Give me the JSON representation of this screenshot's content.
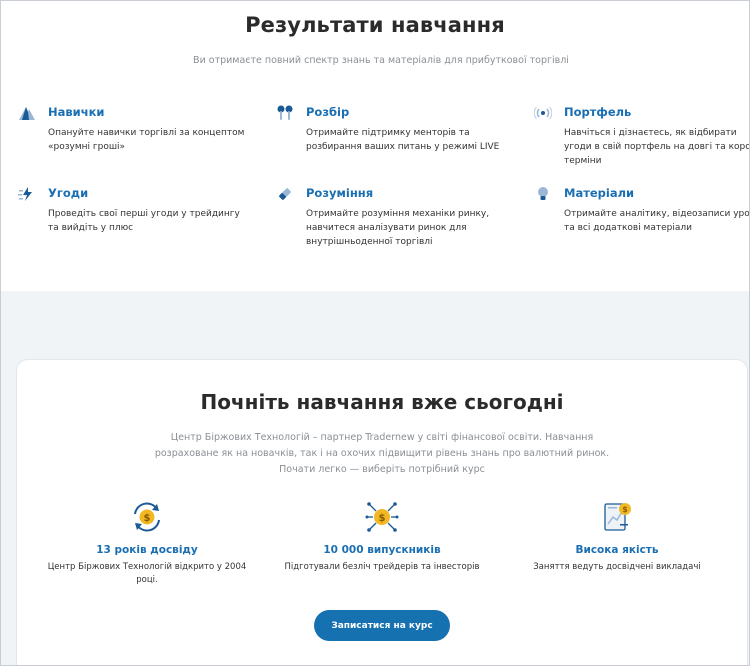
{
  "results": {
    "title": "Результати навчання",
    "subtitle": "Ви отримаєте повний спектр знань та матеріалів для прибуткової торгівлі",
    "features": [
      {
        "icon": "mountain-icon",
        "title": "Навички",
        "desc": "Опануйте навички торгівлі за концептом «розумні гроші»"
      },
      {
        "icon": "earbuds-icon",
        "title": "Розбір",
        "desc": "Отримайте підтримку менторів та розбирання ваших питань у режимі LIVE"
      },
      {
        "icon": "broadcast-icon",
        "title": "Портфель",
        "desc": "Навчіться і дізнаєтесь, як відбирати угоди в свій портфель на довгі та короткі терміни"
      },
      {
        "icon": "lightning-icon",
        "title": "Угоди",
        "desc": "Проведіть свої перші угоди у трейдингу та вийдіть у плюс"
      },
      {
        "icon": "eraser-icon",
        "title": "Розуміння",
        "desc": "Отримайте розуміння механіки ринку, навчитеся аналізувати ринок для внутрішньоденної торгівлі"
      },
      {
        "icon": "lightbulb-icon",
        "title": "Матеріали",
        "desc": "Отримайте аналітику, відеозаписи уроків та всі додаткові матеріали"
      }
    ]
  },
  "cta_section": {
    "title": "Почніть навчання вже сьогодні",
    "text": "Центр Біржових Технологій – партнер Tradernew у світі фінансової освіти. Навчання розраховане як на новачків, так і на охочих підвищити рівень знань про валютний ринок. Почати легко — виберіть потрібний курс",
    "stats": [
      {
        "icon": "coin-cycle-icon",
        "title": "13 років досвіду",
        "desc": "Центр Біржових Технологій відкрито у 2004 році."
      },
      {
        "icon": "coin-network-icon",
        "title": "10 000 випускників",
        "desc": "Підготували безліч трейдерів та інвесторів"
      },
      {
        "icon": "chart-document-icon",
        "title": "Висока якість",
        "desc": "Заняття ведуть досвідчені викладачі"
      }
    ],
    "button_label": "Записатися на курс"
  },
  "colors": {
    "accent": "#1a6fb3",
    "button": "#1571b0",
    "band": "#f0f4f7",
    "coin": "#f2b824"
  }
}
